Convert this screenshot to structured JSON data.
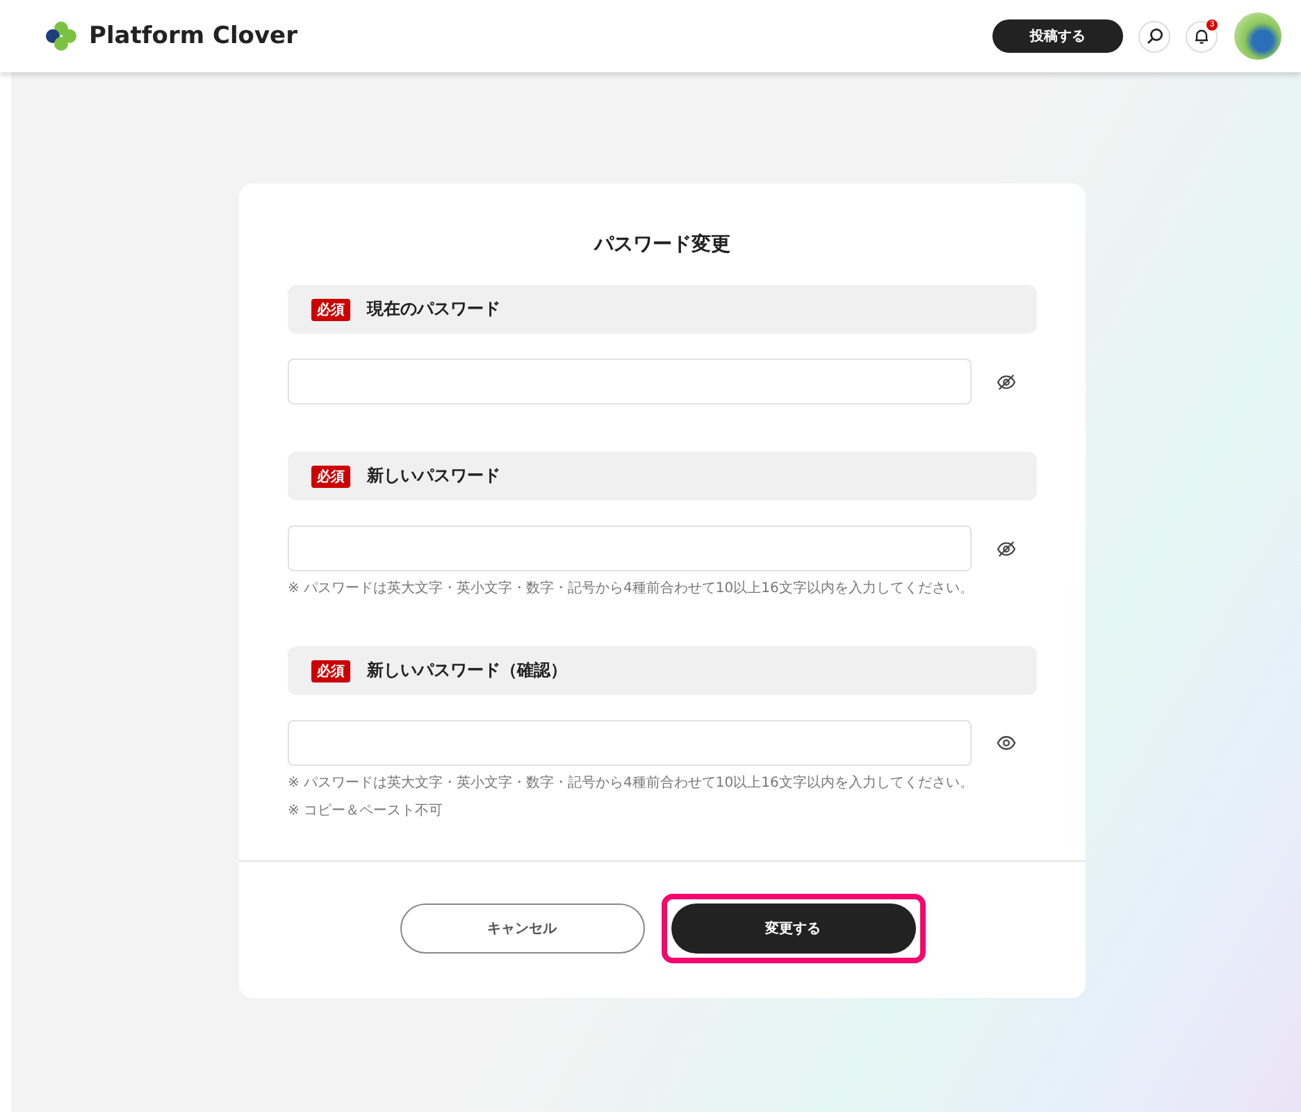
{
  "header": {
    "logo": "Platform Clover",
    "post_button": "投稿する",
    "notification_badge": "3"
  },
  "form": {
    "title": "パスワード変更",
    "fields": [
      {
        "required_badge": "必須",
        "label": "現在のパスワード",
        "masked": true
      },
      {
        "required_badge": "必須",
        "label": "新しいパスワード",
        "masked": true,
        "notes": [
          "※ パスワードは英大文字・英小文字・数字・記号から4種前合わせて10以上16文字以内を入力してください。"
        ]
      },
      {
        "required_badge": "必須",
        "label": "新しいパスワード（確認）",
        "masked": false,
        "notes": [
          "※ パスワードは英大文字・英小文字・数字・記号から4種前合わせて10以上16文字以内を入力してください。",
          "※ コピー＆ペースト不可"
        ]
      }
    ],
    "cancel_button": "キャンセル",
    "submit_button": {
      "label": "変更する",
      "highlighted": true
    }
  }
}
